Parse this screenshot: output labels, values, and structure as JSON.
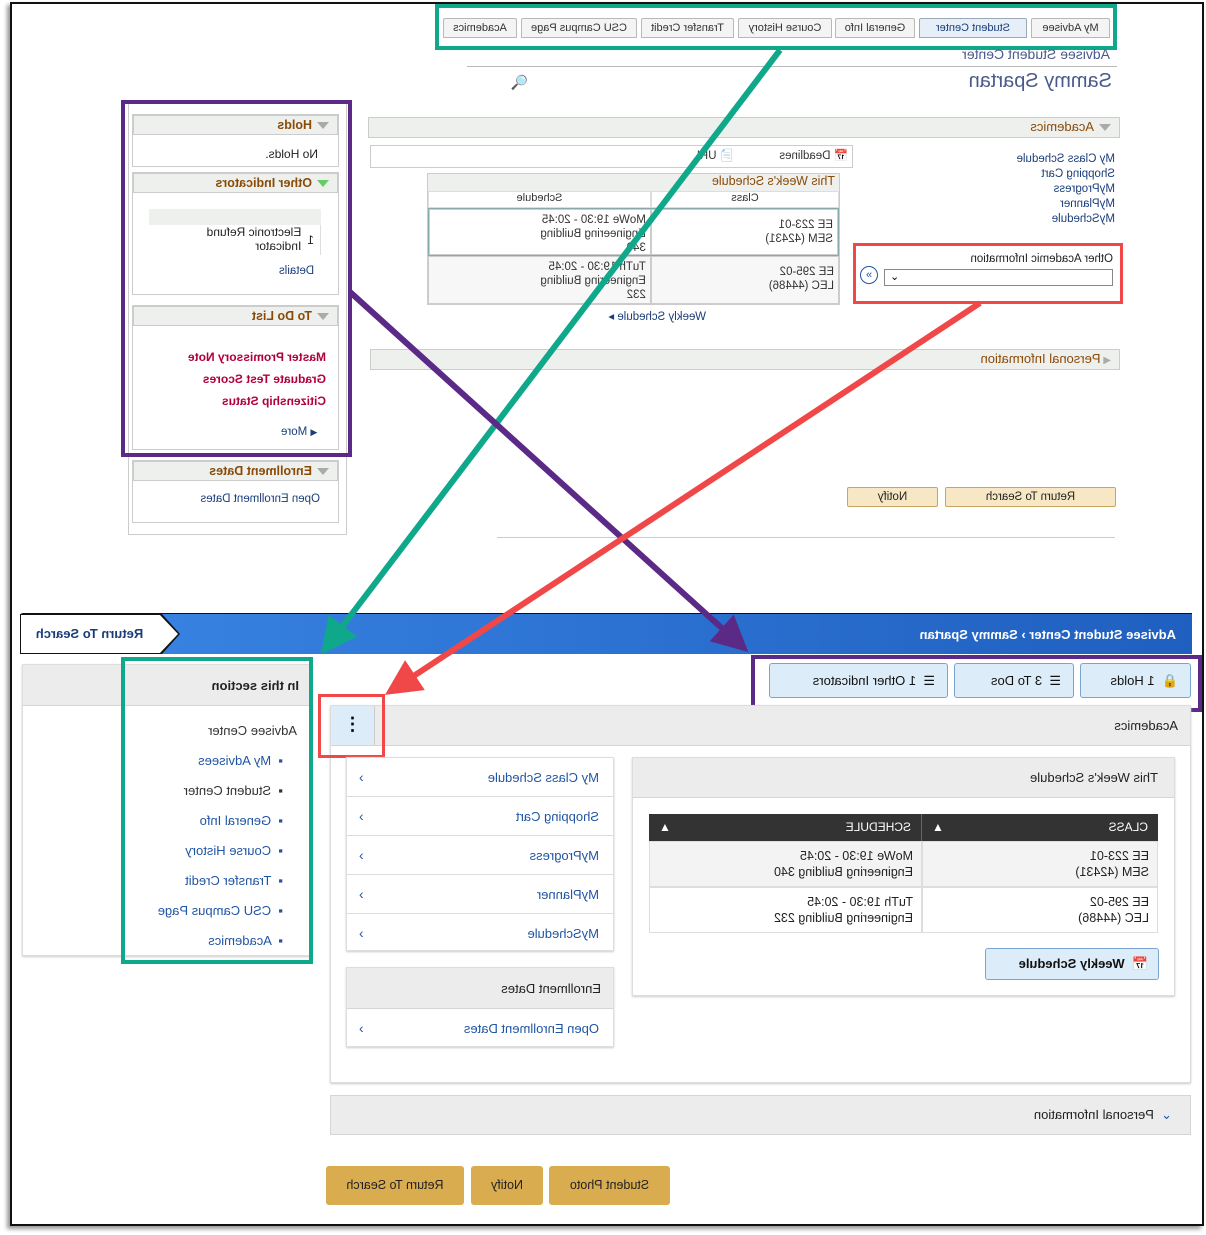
{
  "old_ui": {
    "tabs": [
      "My Advisee",
      "Student Center",
      "General Info",
      "Course History",
      "Transfer Credit",
      "CSU Campus Page",
      "Academics"
    ],
    "selected_tab": "Student Center",
    "page_title": "Advisee Student Center",
    "student_name": "Sammy Spartan",
    "academics": {
      "title": "Academics",
      "links": [
        "My Class Schedule",
        "Shopping Cart",
        "MyProgress",
        "MyPlanner",
        "MySchedule"
      ],
      "deadlines_label": "Deadlines",
      "url_label": "URL",
      "schedule": {
        "title": "This Week's Schedule",
        "headers": [
          "Class",
          "Schedule"
        ],
        "rows": [
          [
            "EE 223-01\nSEM (42431)",
            "MoWe 19:30 - 20:45\nEngineering Building\n340"
          ],
          [
            "EE 295-02\nLEC (44486)",
            "TuTh 19:30 - 20:45\nEngineering Building\n232"
          ]
        ]
      },
      "weekly_link": "Weekly Schedule",
      "other_info_label": "Other Academic Information"
    },
    "personal_info": "Personal Information",
    "buttons": {
      "return": "Return To Search",
      "notify": "Notify"
    },
    "sidebar": {
      "holds": {
        "title": "Holds",
        "text": "No Holds."
      },
      "other": {
        "title": "Other Indicators",
        "count": "1",
        "item": "Electronic Refund Indicator",
        "details": "Details"
      },
      "todo": {
        "title": "To Do List",
        "items": [
          "Master Promissory Note",
          "Graduate Test Scores",
          "Citizenship Status"
        ],
        "more": "More"
      },
      "enroll": {
        "title": "Enrollment Dates",
        "link": "Open Enrollment Dates"
      }
    }
  },
  "new_ui": {
    "breadcrumb": [
      "Advisee Student Center",
      "Sammy Spartan"
    ],
    "return_button": "Return To Search",
    "indicators": [
      {
        "icon": "lock-icon",
        "label": "1 Holds"
      },
      {
        "icon": "list-icon",
        "label": "3 To Dos"
      },
      {
        "icon": "list-icon",
        "label": "1 Other Indicators"
      }
    ],
    "section_nav": {
      "title": "In this section",
      "header_item": "Advisee Center",
      "items": [
        "My Advisees",
        "Student Center",
        "General Info",
        "Course History",
        "Transfer Credit",
        "CSU Campus Page",
        "Academics"
      ]
    },
    "academics": {
      "title": "Academics",
      "links": [
        "My Class Schedule",
        "Shopping Cart",
        "MyProgress",
        "MyPlanner",
        "MySchedule"
      ],
      "enroll_title": "Enrollment Dates",
      "enroll_link": "Open Enrollment Dates",
      "schedule": {
        "title": "This Week's Schedule",
        "headers": [
          "CLASS",
          "SCHEDULE"
        ],
        "rows": [
          [
            "EE 223-01\nSEM (42431)",
            "MoWe 19:30 - 20:45\nEngineering Building 340"
          ],
          [
            "EE 295-02\nLEC (44486)",
            "TuTh 19:30 - 20:45\nEngineering Building 232"
          ]
        ]
      },
      "weekly_button": "Weekly Schedule"
    },
    "personal_info": "Personal Information",
    "buttons": [
      "Return To Search",
      "Notify",
      "Student Photo"
    ]
  },
  "colors": {
    "green": "#10a88a",
    "purple": "#5b2a86",
    "red": "#f04848",
    "banner": "#2a6fd0",
    "gold": "#d9ad4f"
  }
}
